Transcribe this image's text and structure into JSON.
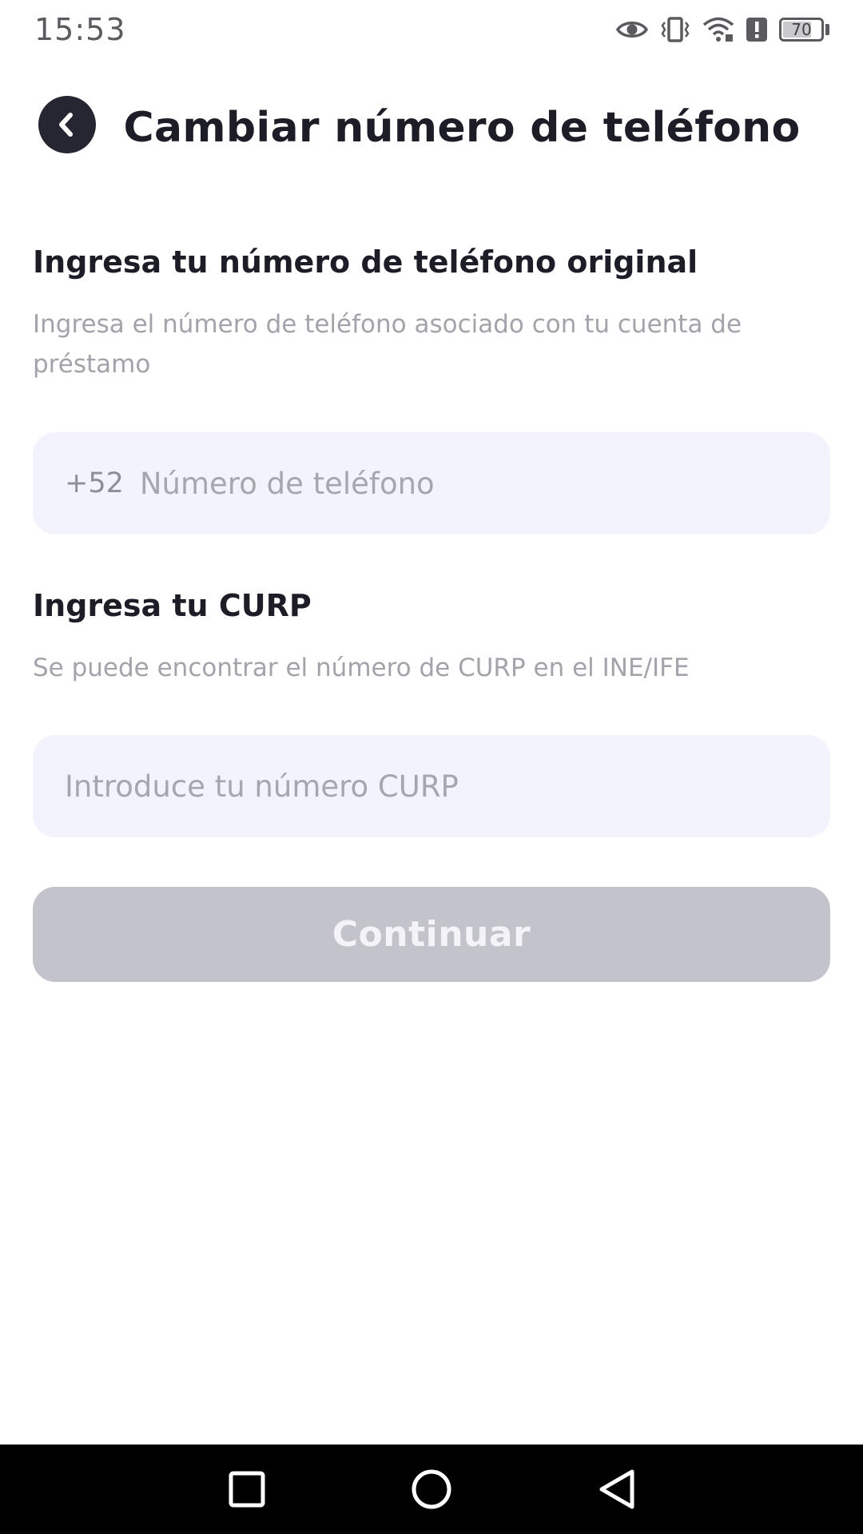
{
  "status_bar": {
    "time": "15:53",
    "battery": "70",
    "icons": [
      "eye-icon",
      "vibrate-icon",
      "wifi-icon",
      "alert-icon",
      "battery-icon"
    ]
  },
  "header": {
    "back_icon": "chevron-left-icon",
    "title": "Cambiar número de teléfono"
  },
  "phone_section": {
    "heading": "Ingresa tu número de teléfono original",
    "description": "Ingresa el número de teléfono asociado con tu cuenta de préstamo",
    "country_code": "+52",
    "placeholder": "Número de teléfono",
    "value": ""
  },
  "curp_section": {
    "heading": "Ingresa tu CURP",
    "description": "Se puede encontrar el número de CURP en el INE/IFE",
    "placeholder": "Introduce tu número CURP",
    "value": ""
  },
  "continue_button": {
    "label": "Continuar",
    "enabled": false
  },
  "nav_bar": {
    "icons": [
      "recents-square-icon",
      "home-circle-icon",
      "back-triangle-icon"
    ]
  },
  "colors": {
    "title_text": "#1d1d28",
    "secondary_text": "#a3a3ab",
    "input_background": "#f3f3fd",
    "button_disabled": "#c3c3cb",
    "back_button_bg": "#262633"
  }
}
